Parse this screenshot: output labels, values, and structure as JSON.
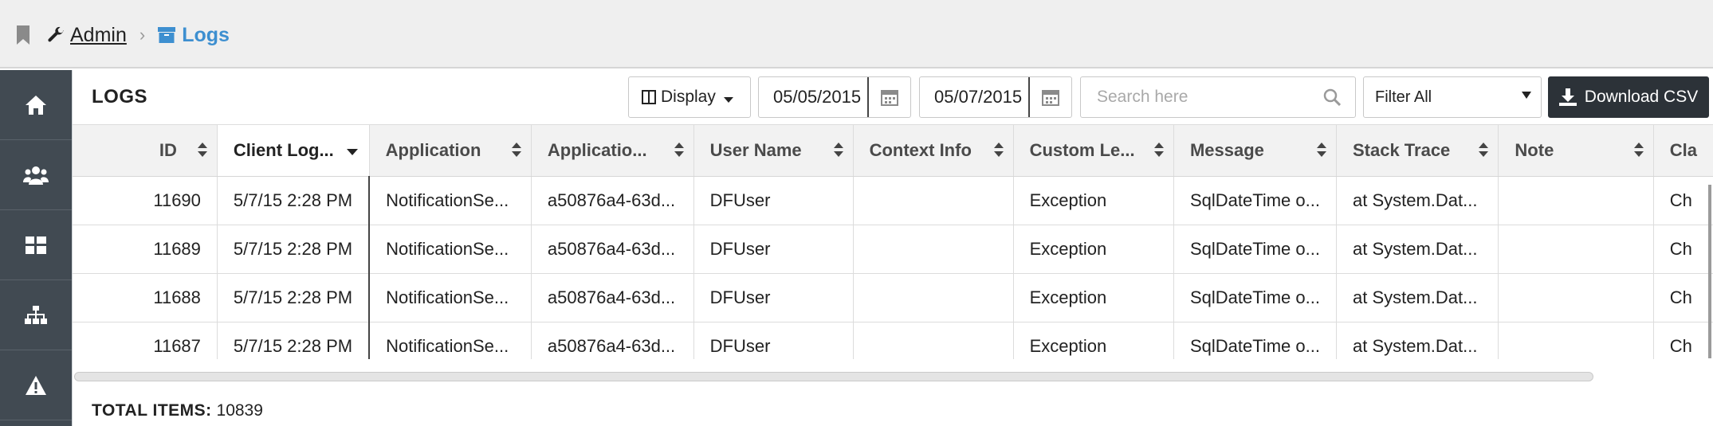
{
  "breadcrumb": {
    "admin": "Admin",
    "separator": "›",
    "current": "Logs"
  },
  "sidebar": {
    "items": [
      "home-icon",
      "users-icon",
      "dashboard-icon",
      "sitemap-icon",
      "warning-icon"
    ]
  },
  "page": {
    "title": "LOGS"
  },
  "toolbar": {
    "display_label": "Display",
    "date_from": "05/05/2015",
    "date_to": "05/07/2015",
    "search_placeholder": "Search here",
    "filter_value": "Filter All",
    "download_label": "Download CSV"
  },
  "table": {
    "columns": [
      "ID",
      "Client Log...",
      "Application",
      "Applicatio...",
      "User Name",
      "Context Info",
      "Custom Le...",
      "Message",
      "Stack Trace",
      "Note",
      "Cla"
    ],
    "rows": [
      [
        "11690",
        "5/7/15 2:28 PM",
        "NotificationSe...",
        "a50876a4-63d...",
        "DFUser",
        "",
        "Exception",
        "SqlDateTime o...",
        "at System.Dat...",
        "",
        "Ch"
      ],
      [
        "11689",
        "5/7/15 2:28 PM",
        "NotificationSe...",
        "a50876a4-63d...",
        "DFUser",
        "",
        "Exception",
        "SqlDateTime o...",
        "at System.Dat...",
        "",
        "Ch"
      ],
      [
        "11688",
        "5/7/15 2:28 PM",
        "NotificationSe...",
        "a50876a4-63d...",
        "DFUser",
        "",
        "Exception",
        "SqlDateTime o...",
        "at System.Dat...",
        "",
        "Ch"
      ],
      [
        "11687",
        "5/7/15 2:28 PM",
        "NotificationSe...",
        "a50876a4-63d...",
        "DFUser",
        "",
        "Exception",
        "SqlDateTime o...",
        "at System.Dat...",
        "",
        "Ch"
      ]
    ]
  },
  "footer": {
    "total_label": "TOTAL ITEMS:",
    "total_value": "10839"
  },
  "colors": {
    "accent": "#3d8fd0",
    "sidebar": "#414a52",
    "download_button": "#2c3238"
  }
}
